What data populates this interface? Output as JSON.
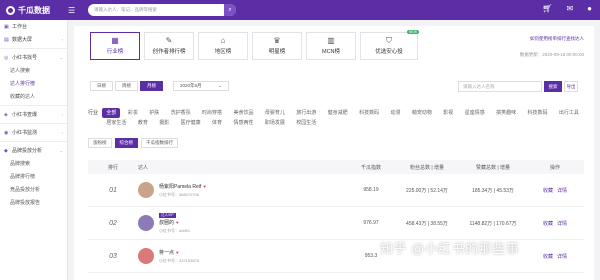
{
  "brand": {
    "name": "千瓜数据"
  },
  "search": {
    "placeholder": "请输入达人、笔记、品牌等搜索"
  },
  "sidebar": {
    "items": [
      {
        "label": "工作台",
        "icon": "home-icon"
      },
      {
        "label": "数据大屏",
        "icon": "screen-icon"
      },
      {
        "label": "小红书找号",
        "icon": "find-icon",
        "expanded": true
      },
      {
        "label": "达人搜索",
        "sub": true
      },
      {
        "label": "达人排行榜",
        "sub": true,
        "active": true
      },
      {
        "label": "收藏的达人",
        "sub": true
      },
      {
        "label": "小红书查爆",
        "icon": "hot-icon"
      },
      {
        "label": "小红书监测",
        "icon": "monitor-icon"
      },
      {
        "label": "品牌投放分析",
        "icon": "brand-icon",
        "expanded": true
      },
      {
        "label": "品牌搜索",
        "sub": true
      },
      {
        "label": "品牌排行榜",
        "sub": true
      },
      {
        "label": "竞品投放分析",
        "sub": true
      },
      {
        "label": "品牌投放报告",
        "sub": true
      }
    ]
  },
  "nav": {
    "cards": [
      {
        "label": "行业榜",
        "active": true
      },
      {
        "label": "创作者排行榜"
      },
      {
        "label": "地区榜"
      },
      {
        "label": "明星榜"
      },
      {
        "label": "MCN榜"
      },
      {
        "label": "优选安心投",
        "badge": "NEW"
      }
    ],
    "right_link": "如何使用榜单排行查找达人",
    "right_info": "数据更新：2020-09-16 00:00:00"
  },
  "period_tabs": [
    "日榜",
    "周榜",
    "月榜"
  ],
  "date_value": "2020年8月",
  "search2": {
    "placeholder": "请输入达人名称",
    "btn": "搜索",
    "export": "导出"
  },
  "categories": {
    "label": "行业",
    "row1": [
      "全部",
      "彩妆",
      "护肤",
      "洗护香氛",
      "时尚穿搭",
      "美食饮品",
      "母婴育儿",
      "旅行出游",
      "健身减肥",
      "科技数码",
      "动漫",
      "萌宠动物",
      "影视",
      "星座情感",
      "搞笑趣味",
      "科技数码",
      "出行工具"
    ],
    "row2": [
      "居家生活",
      "教育",
      "摄影",
      "医疗健康",
      "体育",
      "情感两性",
      "职场发展",
      "校园生活"
    ]
  },
  "sub_tabs": [
    "涨粉榜",
    "综合榜",
    "千瓜指数排行"
  ],
  "table": {
    "headers": [
      "排行",
      "达人",
      "千瓜指数",
      "粉丝总数 | 增量",
      "赞藏总数 | 增量",
      "操作"
    ],
    "rows": [
      {
        "rank": "01",
        "name": "杨紫阳Pamela Reif",
        "id": "小红书号：588070706",
        "index": "958.19",
        "fans": "225.00万 | 52.14万",
        "inter": "185.34万 | 45.53万",
        "op1": "收藏",
        "op2": "详情",
        "avatar_color": "#c9a38a"
      },
      {
        "rank": "02",
        "name": "叔圈的",
        "id": "小红书号：ddd91",
        "tag": "达人VIP",
        "index": "976.97",
        "fans": "458.43万 | 38.55万",
        "inter": "1148.82万 | 170.67万",
        "op1": "收藏",
        "op2": "详情",
        "avatar_color": "#8d7bb8"
      },
      {
        "rank": "03",
        "name": "蒋一点",
        "id": "小红书号：437183875",
        "index": "953.3",
        "fans": "",
        "inter": "",
        "op1": "收藏",
        "op2": "详情",
        "avatar_color": "#d97a7a"
      }
    ]
  },
  "watermark": "知乎 @小红书的那些事"
}
